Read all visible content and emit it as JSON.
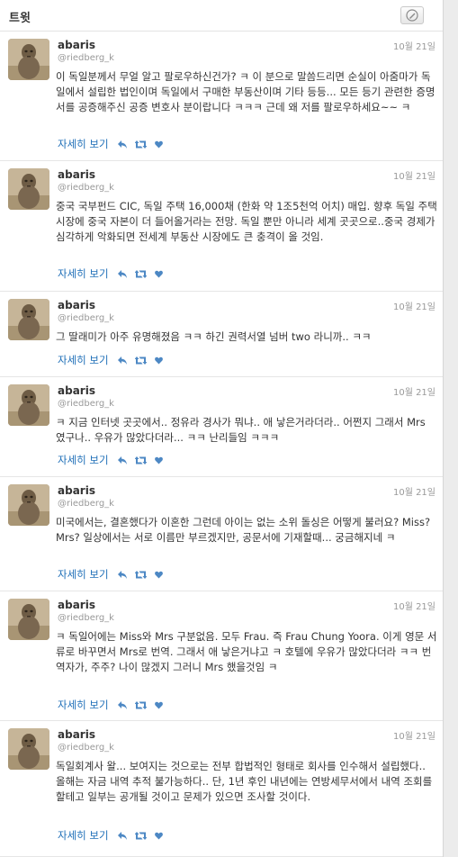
{
  "header": {
    "title": "트윗",
    "compose_icon": "compose-pen-icon"
  },
  "actions": {
    "detail_label": "자세히 보기",
    "icons": [
      "reply-arrow-icon",
      "retweet-icon",
      "favorite-heart-icon"
    ]
  },
  "colors": {
    "link": "#1f6fb8",
    "icon": "#4d88c4",
    "muted": "#999999",
    "text": "#333333"
  },
  "tweets": [
    {
      "name": "abaris",
      "handle": "@riedberg_k",
      "time": "10월 21일",
      "text": "이 독일분께서 무얼 알고 팔로우하신건가? ㅋ 이 분으로 말씀드리면 순실이 아줌마가 독일에서 설립한 법인이며 독일에서 구매한 부동산이며 기타 등등... 모든 등기 관련한 증명서를 공증해주신 공증 변호사 분이랍니다 ㅋㅋㅋ 근데 왜 저를 팔로우하세요~~ ㅋ"
    },
    {
      "name": "abaris",
      "handle": "@riedberg_k",
      "time": "10월 21일",
      "text": "중국 국부펀드 CIC, 독일 주택 16,000채 (한화 약 1조5천억 어치) 매입. 향후 독일 주택시장에 중국 자본이 더 들어올거라는 전망. 독일 뿐만 아니라 세계 곳곳으로..중국 경제가 심각하게 악화되면 전세계 부동산 시장에도 큰 충격이 올 것임."
    },
    {
      "name": "abaris",
      "handle": "@riedberg_k",
      "time": "10월 21일",
      "text": "그 딸래미가 아주 유명해졌음 ㅋㅋ 하긴 권력서열 넘버 two 라니까.. ㅋㅋ"
    },
    {
      "name": "abaris",
      "handle": "@riedberg_k",
      "time": "10월 21일",
      "text": "ㅋ 지금 인터넷 곳곳에서.. 정유라 경사가 뭐냐.. 애 낳은거라더라.. 어쩐지 그래서 Mrs 였구나.. 우유가 많았다더라... ㅋㅋ 난리들임 ㅋㅋㅋ"
    },
    {
      "name": "abaris",
      "handle": "@riedberg_k",
      "time": "10월 21일",
      "text": "미국에서는, 결혼했다가 이혼한 그런데 아이는 없는 소위 돌싱은 어떻게 불러요? Miss? Mrs? 일상에서는 서로 이름만 부르겠지만, 공문서에 기재할때... 궁금해지네 ㅋ"
    },
    {
      "name": "abaris",
      "handle": "@riedberg_k",
      "time": "10월 21일",
      "text": "ㅋ 독일어에는 Miss와 Mrs 구분없음. 모두 Frau. 즉 Frau Chung Yoora. 이게 영문 서류로 바꾸면서 Mrs로 번역. 그래서 애 낳은거냐고 ㅋ 호텔에 우유가 많았다더라 ㅋㅋ 번역자가, 주주? 나이 많겠지 그러니 Mrs 했을것임 ㅋ"
    },
    {
      "name": "abaris",
      "handle": "@riedberg_k",
      "time": "10월 21일",
      "text": "독일회계사 왈... 보여지는 것으로는 전부 합법적인 형태로 회사를 인수해서 설립했다.. 올해는 자금 내역 추적 불가능하다.. 단, 1년 후인 내년에는 연방세무서에서 내역 조회를 할테고 일부는 공개될 것이고 문제가 있으면 조사할 것이다."
    }
  ]
}
